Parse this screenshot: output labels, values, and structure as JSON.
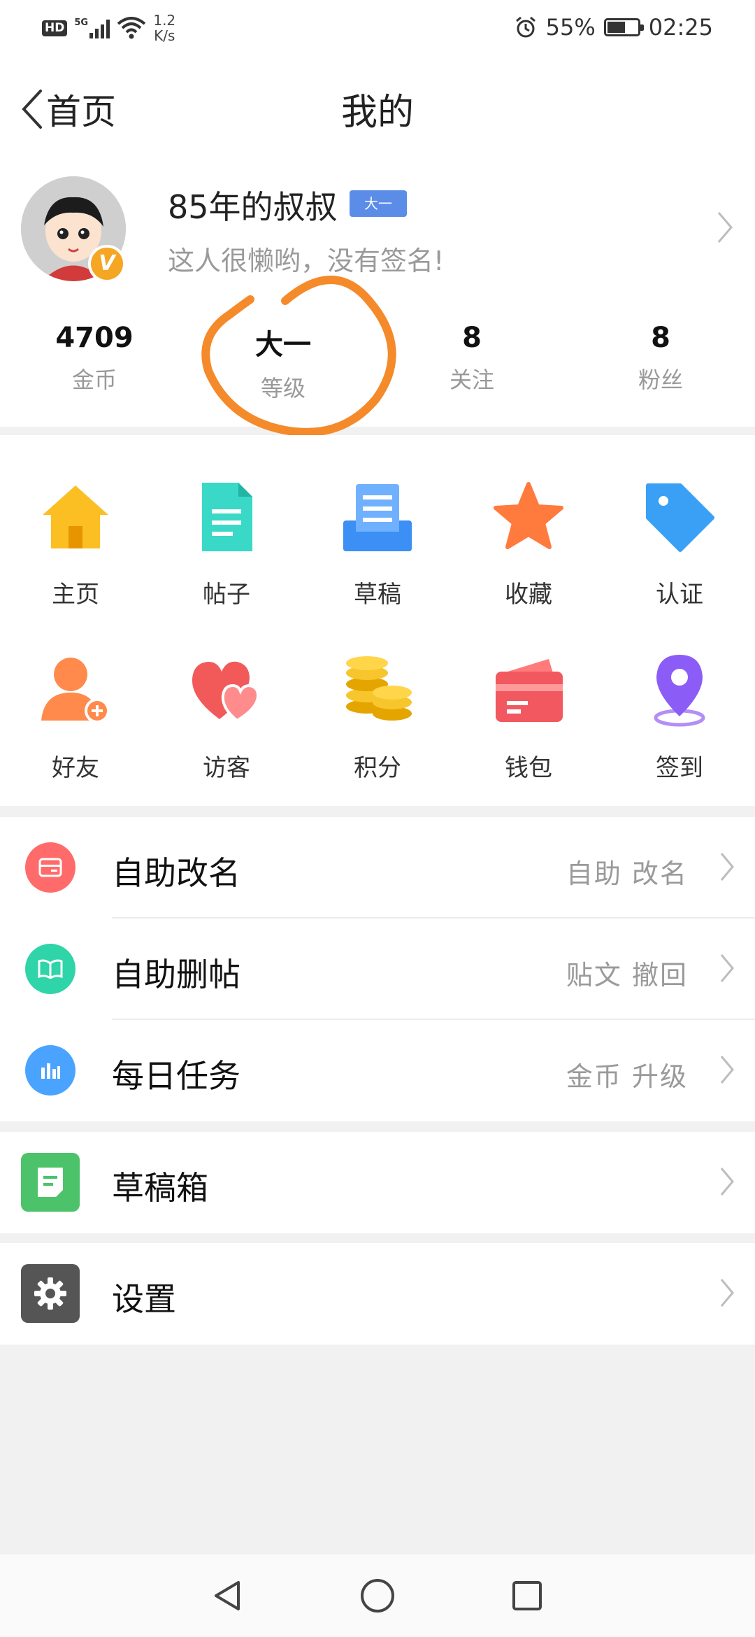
{
  "status_bar": {
    "hd": "HD",
    "network": "5G",
    "speed_value": "1.2",
    "speed_unit": "K/s",
    "battery": "55%",
    "time": "02:25"
  },
  "header": {
    "back_label": "首页",
    "title": "我的"
  },
  "profile": {
    "username": "85年的叔叔",
    "level_tag": "大一",
    "signature": "这人很懒哟，没有签名!",
    "verified_badge": "V",
    "stats": [
      {
        "value": "4709",
        "label": "金币"
      },
      {
        "value": "大一",
        "label": "等级"
      },
      {
        "value": "8",
        "label": "关注"
      },
      {
        "value": "8",
        "label": "粉丝"
      }
    ]
  },
  "grid": {
    "items": [
      {
        "label": "主页",
        "icon": "home-icon"
      },
      {
        "label": "帖子",
        "icon": "post-icon"
      },
      {
        "label": "草稿",
        "icon": "draft-icon"
      },
      {
        "label": "收藏",
        "icon": "star-icon"
      },
      {
        "label": "认证",
        "icon": "tag-icon"
      },
      {
        "label": "好友",
        "icon": "add-friend-icon"
      },
      {
        "label": "访客",
        "icon": "visitor-heart-icon"
      },
      {
        "label": "积分",
        "icon": "coins-icon"
      },
      {
        "label": "钱包",
        "icon": "wallet-icon"
      },
      {
        "label": "签到",
        "icon": "location-pin-icon"
      }
    ]
  },
  "menu": {
    "items": [
      {
        "label": "自助改名",
        "right": "自助  改名"
      },
      {
        "label": "自助删帖",
        "right": "贴文  撤回"
      },
      {
        "label": "每日任务",
        "right": "金币  升级"
      }
    ],
    "drafts": {
      "label": "草稿箱"
    },
    "settings": {
      "label": "设置"
    }
  },
  "colors": {
    "annotation_circle": "#f58a2a",
    "level_tag": "#5b8de8",
    "verified_badge": "#f5a623"
  }
}
